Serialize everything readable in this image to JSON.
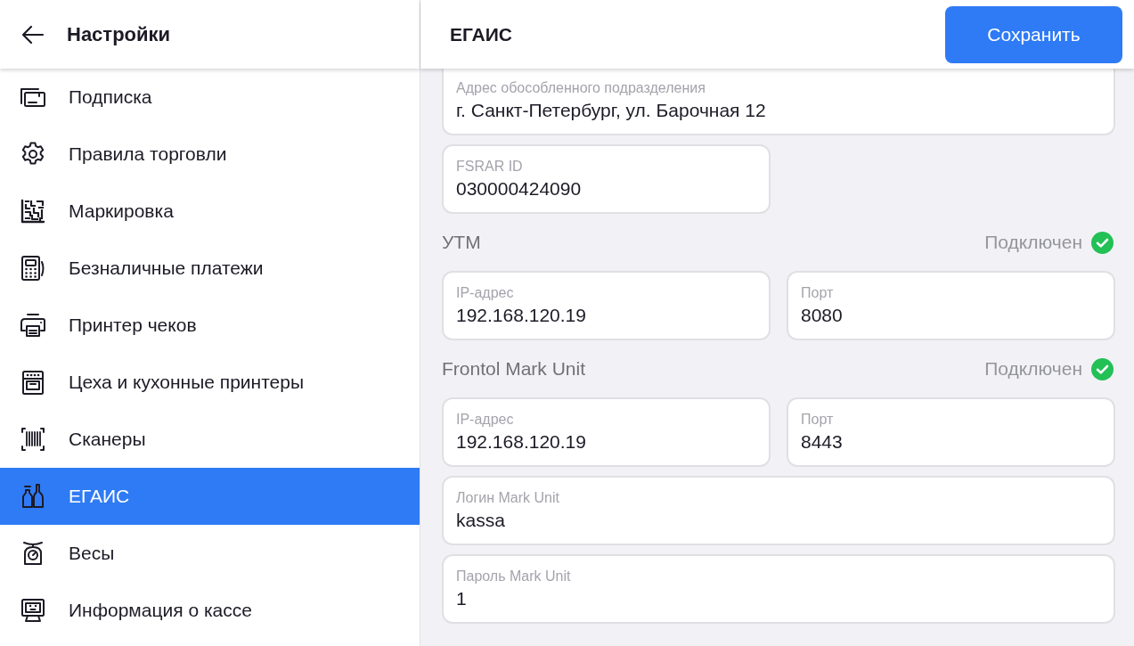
{
  "sidebar": {
    "title": "Настройки",
    "items": [
      {
        "label": "Подписка",
        "selected": false
      },
      {
        "label": "Правила торговли",
        "selected": false
      },
      {
        "label": "Маркировка",
        "selected": false
      },
      {
        "label": "Безналичные платежи",
        "selected": false
      },
      {
        "label": "Принтер чеков",
        "selected": false
      },
      {
        "label": "Цеха и кухонные принтеры",
        "selected": false
      },
      {
        "label": "Сканеры",
        "selected": false
      },
      {
        "label": "ЕГАИС",
        "selected": true
      },
      {
        "label": "Весы",
        "selected": false
      },
      {
        "label": "Информация о кассе",
        "selected": false
      }
    ]
  },
  "header": {
    "title": "ЕГАИС",
    "save_button": "Сохранить"
  },
  "form": {
    "fields": [
      {
        "label": "Адрес обособленного подразделения",
        "value": "г. Санкт-Петербург, ул. Барочная 12"
      },
      {
        "label": "FSRAR ID",
        "value": "030000424090"
      }
    ],
    "sections": [
      {
        "title": "УТМ",
        "status": {
          "label": "Подключен",
          "connected": true
        },
        "fields": [
          {
            "label": "IP-адрес",
            "value": "192.168.120.19"
          },
          {
            "label": "Порт",
            "value": "8080"
          }
        ]
      },
      {
        "title": "Frontol Mark Unit",
        "status": {
          "label": "Подключен",
          "connected": true
        },
        "fields": [
          {
            "label": "IP-адрес",
            "value": "192.168.120.19"
          },
          {
            "label": "Порт",
            "value": "8443"
          },
          {
            "label": "Логин Mark Unit",
            "value": "kassa"
          },
          {
            "label": "Пароль Mark Unit",
            "value": "1"
          }
        ]
      }
    ]
  }
}
